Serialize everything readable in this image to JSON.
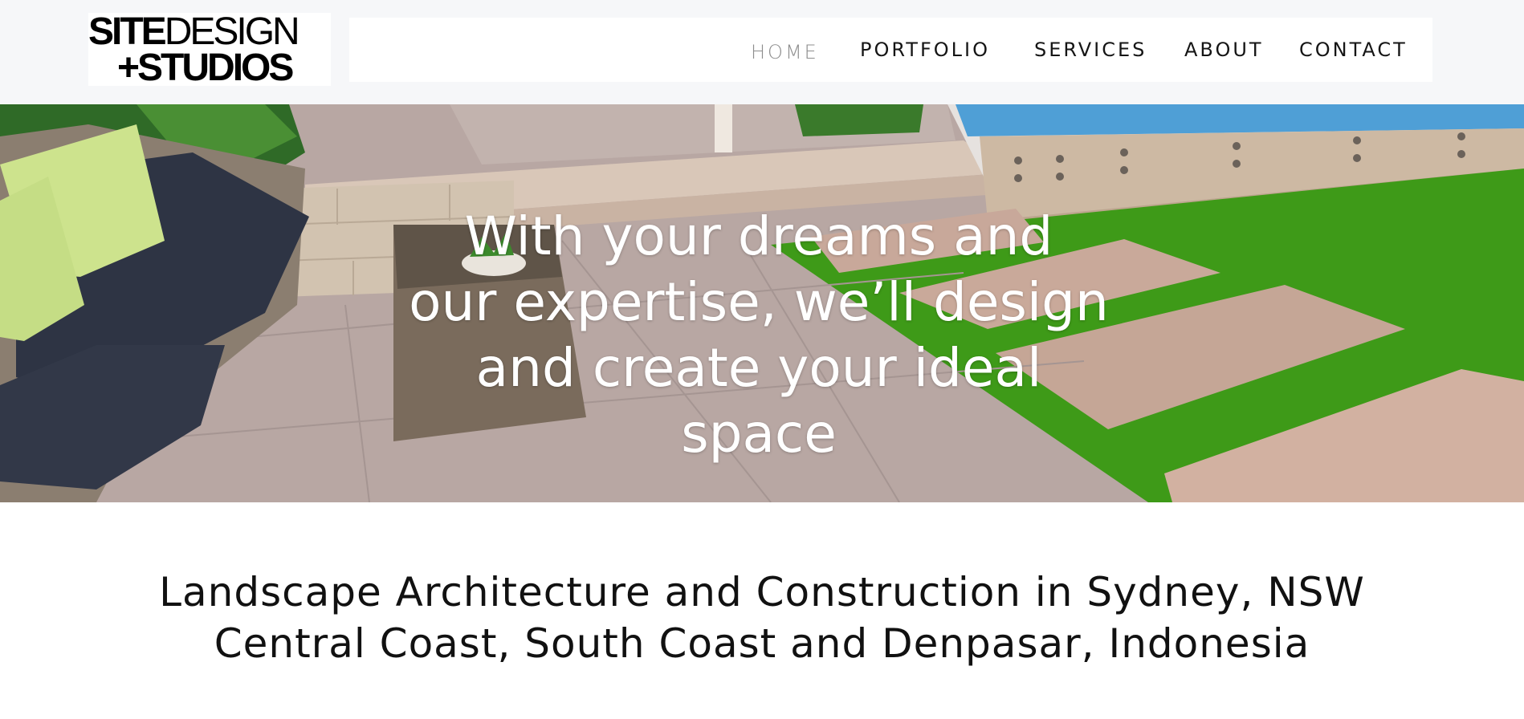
{
  "logo": {
    "line1_bold": "SITE",
    "line1_light": "DESIGN",
    "line2": "+STUDIOS"
  },
  "nav": {
    "items": [
      {
        "label": "HOME",
        "active": true
      },
      {
        "label": "PORTFOLIO",
        "active": false
      },
      {
        "label": "SERVICES",
        "active": false
      },
      {
        "label": "ABOUT",
        "active": false
      },
      {
        "label": "CONTACT",
        "active": false
      }
    ]
  },
  "hero": {
    "heading_lines": [
      "With your dreams and",
      "our expertise, we’ll design",
      "and create your ideal",
      "space"
    ]
  },
  "intro": {
    "lines": [
      "Landscape Architecture and Construction in Sydney, NSW",
      "Central Coast, South Coast and Denpasar, Indonesia"
    ]
  },
  "colors": {
    "header_bg": "#f6f7f9",
    "nav_active": "#8d8d8d",
    "nav_text": "#151515",
    "lawn": "#3e9a18",
    "pool": "#4f9fd6"
  }
}
